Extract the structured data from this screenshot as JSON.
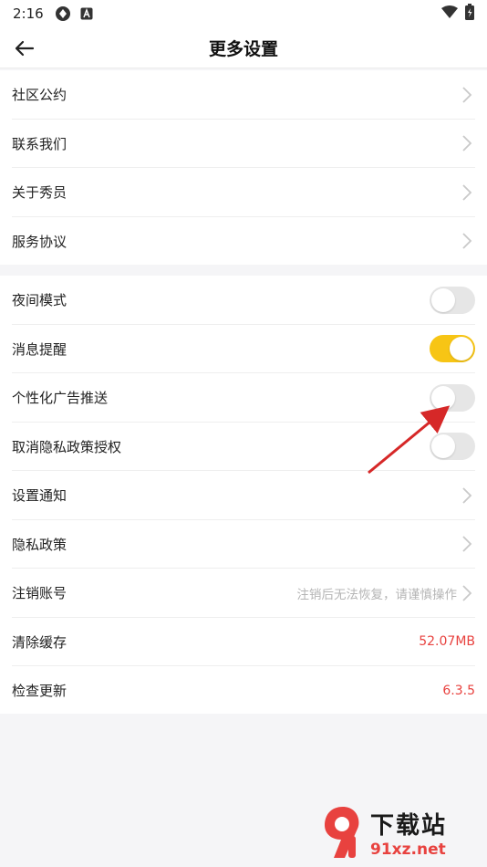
{
  "status_bar": {
    "time": "2:16"
  },
  "nav": {
    "title": "更多设置"
  },
  "group1": [
    {
      "label": "社区公约"
    },
    {
      "label": "联系我们"
    },
    {
      "label": "关于秀员"
    },
    {
      "label": "服务协议"
    }
  ],
  "group2": {
    "night_mode": {
      "label": "夜间模式",
      "on": false
    },
    "notifications": {
      "label": "消息提醒",
      "on": true
    },
    "personalized_ads": {
      "label": "个性化广告推送",
      "on": false
    },
    "revoke_privacy": {
      "label": "取消隐私政策授权",
      "on": false
    },
    "notification_settings": {
      "label": "设置通知"
    },
    "privacy_policy": {
      "label": "隐私政策"
    },
    "delete_account": {
      "label": "注销账号",
      "hint": "注销后无法恢复，请谨慎操作"
    },
    "clear_cache": {
      "label": "清除缓存",
      "value": "52.07MB"
    },
    "check_update": {
      "label": "检查更新",
      "value": "6.3.5"
    }
  },
  "watermark": {
    "title": "下载站",
    "url": "91xz.net"
  },
  "colors": {
    "accent": "#f7c515",
    "value_red": "#e8423f",
    "annotation_arrow": "#d62828"
  }
}
